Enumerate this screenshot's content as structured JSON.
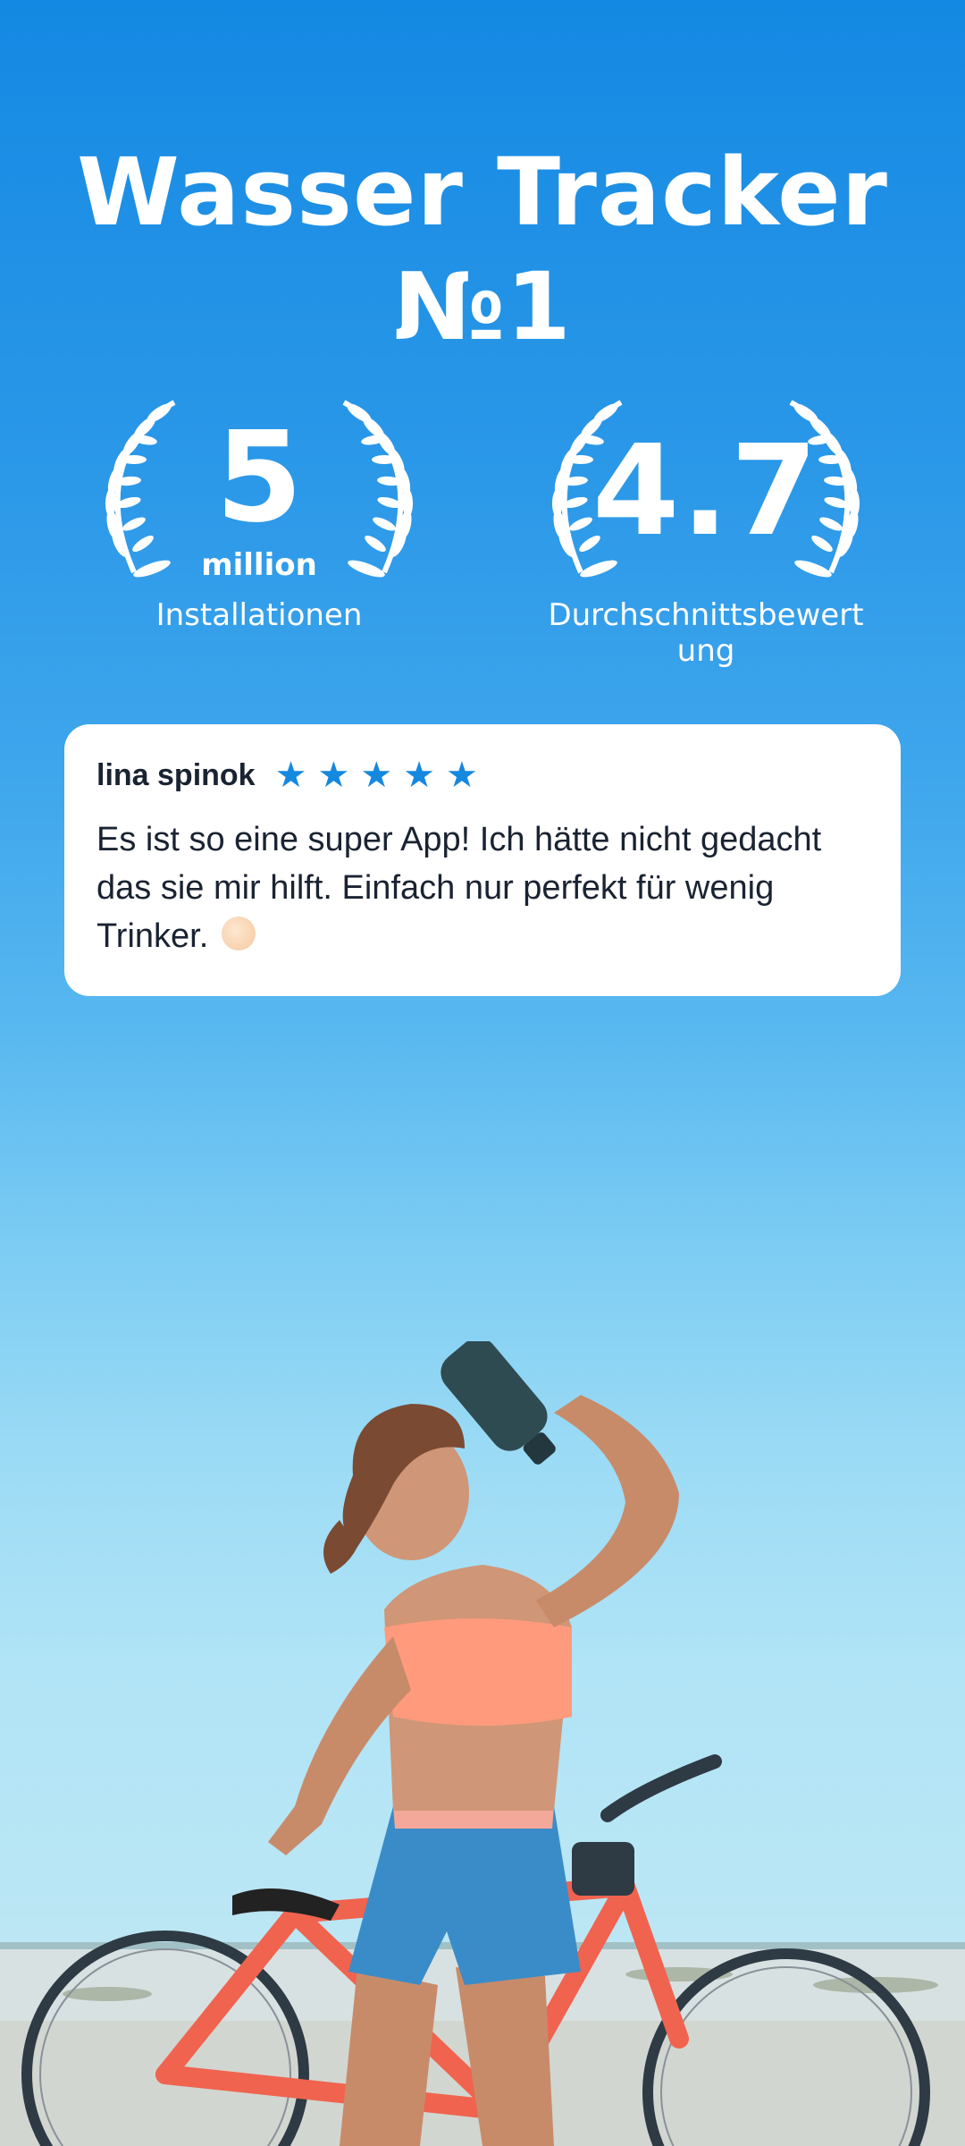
{
  "header": {
    "title_line1": "Wasser Tracker",
    "title_line2": "№1"
  },
  "badges": {
    "installs": {
      "number": "5",
      "unit": "million",
      "caption": "Installationen"
    },
    "rating": {
      "number": "4.7",
      "caption_line1": "Durchschnittsbewert",
      "caption_line2": "ung"
    }
  },
  "review": {
    "author": "lina spinok",
    "stars": 5,
    "text": "Es ist so eine super App! Ich hätte nicht gedacht das sie mir hilft. Einfach nur perfekt für wenig Trinker.",
    "emoji": "ok-hand-icon"
  },
  "colors": {
    "background_top": "#1489e3",
    "star": "#1588e0",
    "text_dark": "#1a2332"
  }
}
